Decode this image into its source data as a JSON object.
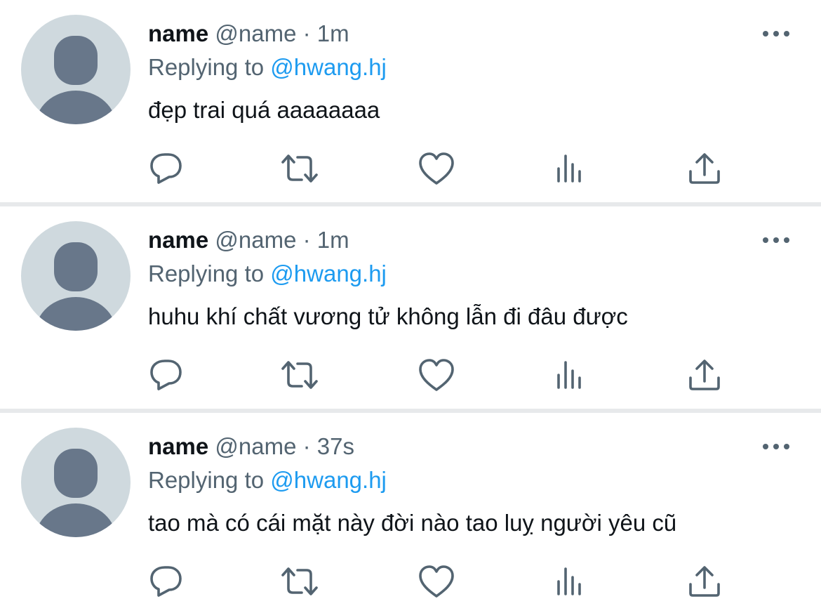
{
  "tweets": [
    {
      "display_name": "name",
      "handle": "@name",
      "separator": "·",
      "time": "1m",
      "replying_to_label": "Replying to",
      "replying_to_handle": "@hwang.hj",
      "text": "đẹp trai quá aaaaaaaa"
    },
    {
      "display_name": "name",
      "handle": "@name",
      "separator": "·",
      "time": "1m",
      "replying_to_label": "Replying to",
      "replying_to_handle": "@hwang.hj",
      "text": "huhu khí chất vương tử không lẫn đi đâu được"
    },
    {
      "display_name": "name",
      "handle": "@name",
      "separator": "·",
      "time": "37s",
      "replying_to_label": "Replying to",
      "replying_to_handle": "@hwang.hj",
      "text": "tao mà có cái mặt này đời nào tao luỵ người yêu cũ"
    }
  ],
  "icons": {
    "avatar": "default-avatar-icon",
    "more": "more-horizontal-icon",
    "reply": "reply-icon",
    "retweet": "retweet-icon",
    "like": "like-heart-icon",
    "views": "analytics-icon",
    "share": "share-icon"
  },
  "colors": {
    "text_primary": "#0f1419",
    "text_secondary": "#536471",
    "mention": "#1d9bf0",
    "avatar_bg": "#cfd9de",
    "avatar_fg": "#68778a",
    "icon": "#536471",
    "divider": "#e7e9eb"
  }
}
